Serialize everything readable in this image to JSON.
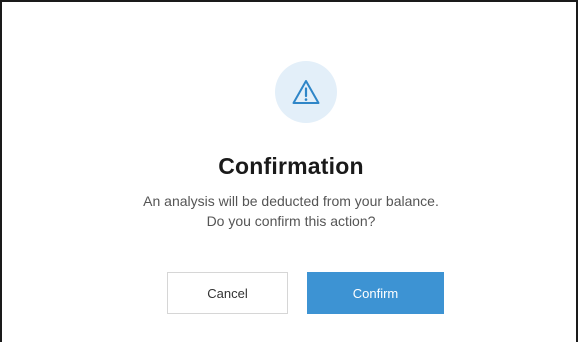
{
  "dialog": {
    "icon": "warning-triangle-icon",
    "title": "Confirmation",
    "message_line1": "An analysis will be deducted from your balance.",
    "message_line2": "Do you confirm this action?",
    "cancel_label": "Cancel",
    "confirm_label": "Confirm"
  },
  "colors": {
    "accent": "#3d93d3",
    "icon_bg": "#e3eff9",
    "icon_stroke": "#2f86c8",
    "title": "#1a1a1a",
    "message": "#555555"
  }
}
